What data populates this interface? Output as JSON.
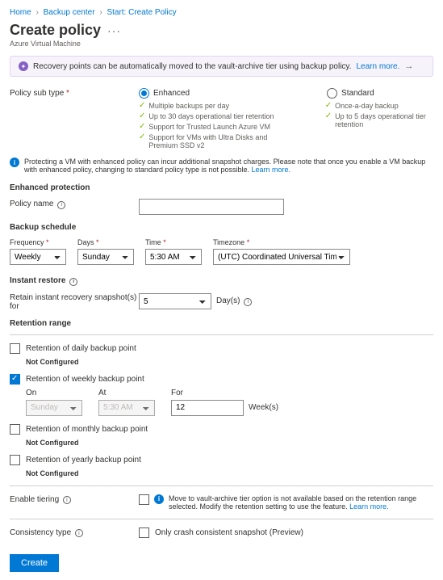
{
  "breadcrumb": {
    "home": "Home",
    "center": "Backup center",
    "start": "Start: Create Policy"
  },
  "title": "Create policy",
  "subtitle": "Azure Virtual Machine",
  "infobar": {
    "text": "Recovery points can be automatically moved to the vault-archive tier using backup policy.",
    "learn": "Learn more."
  },
  "subtype_label": "Policy sub type",
  "enhanced": {
    "name": "Enhanced",
    "f1": "Multiple backups per day",
    "f2": "Up to 30 days operational tier retention",
    "f3": "Support for Trusted Launch Azure VM",
    "f4": "Support for VMs with Ultra Disks and Premium SSD v2"
  },
  "standard": {
    "name": "Standard",
    "f1": "Once-a-day backup",
    "f2": "Up to 5 days operational tier retention"
  },
  "warn": {
    "text": "Protecting a VM with enhanced policy can incur additional snapshot charges. Please note that once you enable a VM backup with enhanced policy, changing to standard policy type is not possible.",
    "learn": "Learn more."
  },
  "sections": {
    "enhanced_protection": "Enhanced protection",
    "policy_name": "Policy name",
    "backup_schedule": "Backup schedule",
    "instant_restore": "Instant restore",
    "retention_range": "Retention range"
  },
  "schedule": {
    "freq_lbl": "Frequency",
    "freq_val": "Weekly",
    "days_lbl": "Days",
    "days_val": "Sunday",
    "time_lbl": "Time",
    "time_val": "5:30 AM",
    "tz_lbl": "Timezone",
    "tz_val": "(UTC) Coordinated Universal Time"
  },
  "instant": {
    "label": "Retain instant recovery snapshot(s) for",
    "val": "5",
    "unit": "Day(s)"
  },
  "retention": {
    "daily": {
      "label": "Retention of daily backup point",
      "status": "Not Configured"
    },
    "weekly": {
      "label": "Retention of weekly backup point",
      "on_lbl": "On",
      "on_val": "Sunday",
      "at_lbl": "At",
      "at_val": "5:30 AM",
      "for_lbl": "For",
      "for_val": "12",
      "unit": "Week(s)"
    },
    "monthly": {
      "label": "Retention of monthly backup point",
      "status": "Not Configured"
    },
    "yearly": {
      "label": "Retention of yearly backup point",
      "status": "Not Configured"
    }
  },
  "tiering": {
    "label": "Enable tiering",
    "note": "Move to vault-archive tier option is not available based on the retention range selected. Modify the retention setting to use the feature.",
    "learn": "Learn more."
  },
  "consistency": {
    "label": "Consistency type",
    "opt": "Only crash consistent snapshot (Preview)"
  },
  "create_btn": "Create"
}
